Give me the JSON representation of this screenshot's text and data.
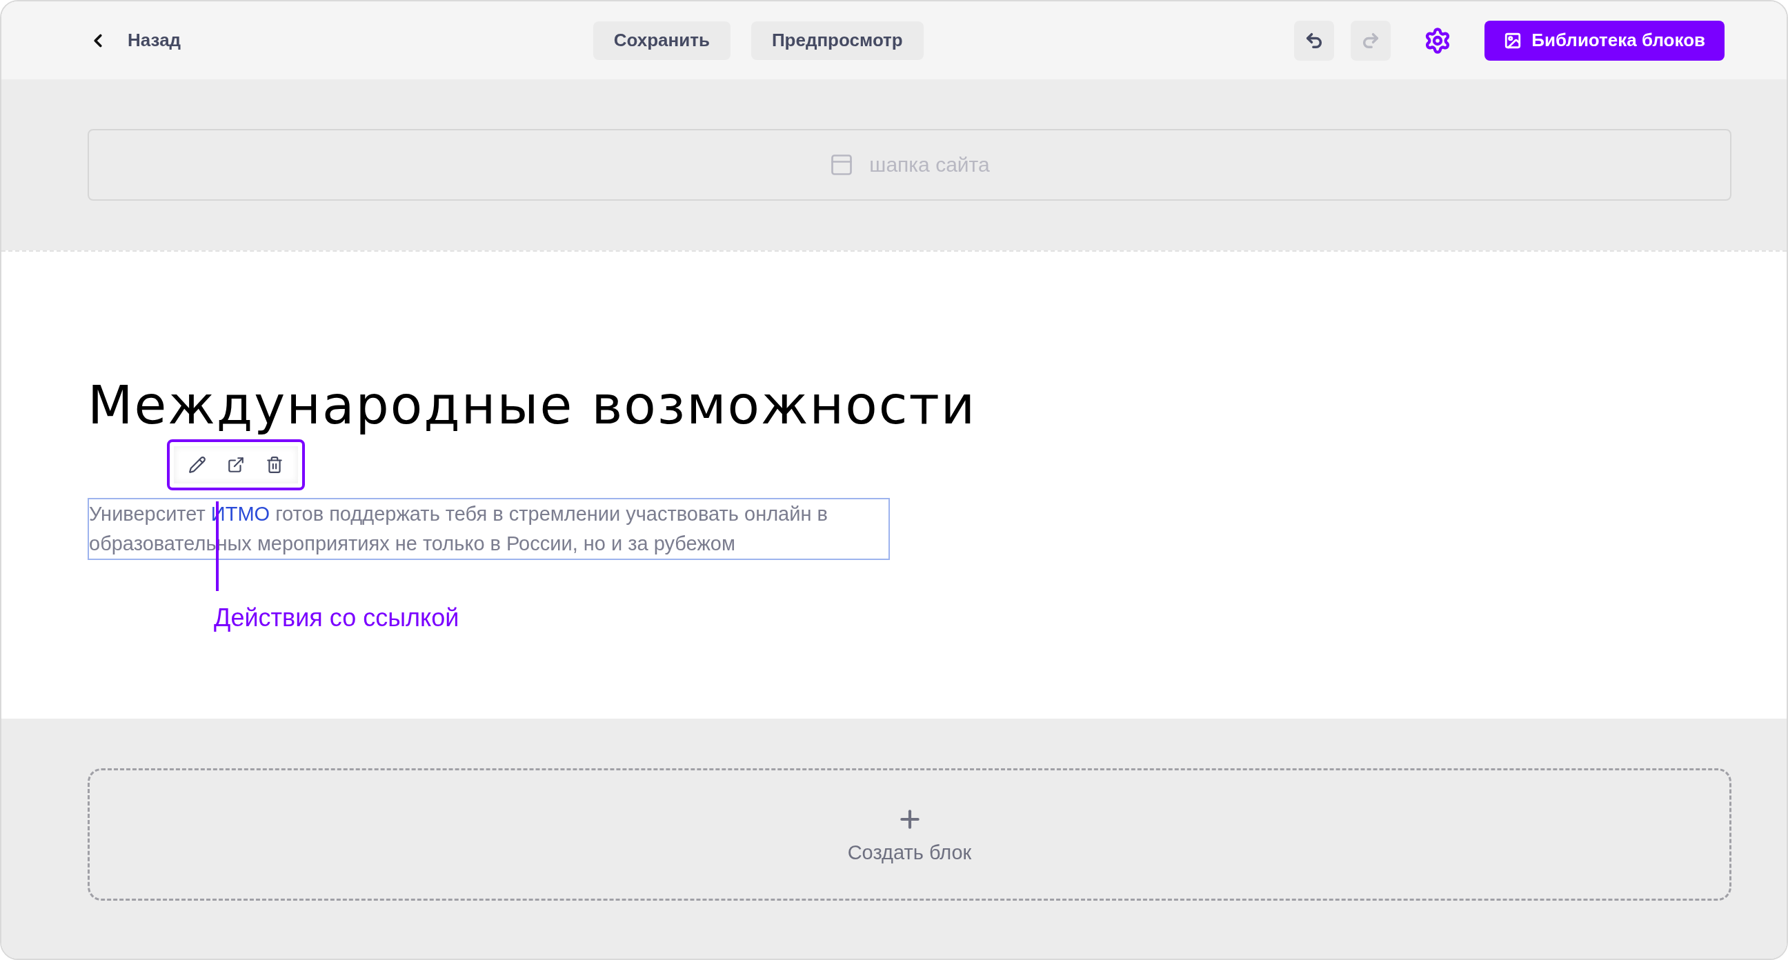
{
  "topbar": {
    "back": "Назад",
    "buttons": [
      {
        "label": "Сохранить"
      },
      {
        "label": "Предпросмотр"
      }
    ],
    "history": [
      {
        "kind": "undo",
        "disabled": false
      },
      {
        "kind": "redo",
        "disabled": true
      }
    ],
    "library_button": "Библиотека блоков"
  },
  "header_block": {
    "label": "шапка сайта"
  },
  "content": {
    "title": "Международные возможности",
    "paragraph": {
      "before": "Университет ",
      "link": "ИТМО",
      "after": " готов поддержать тебя в стремлении участвовать онлайн в образовательных мероприятиях не только в России, но и за рубежом"
    },
    "link_toolbar": {
      "actions": [
        {
          "kind": "edit"
        },
        {
          "kind": "open"
        },
        {
          "kind": "delete"
        }
      ]
    },
    "annotation": "Действия со ссылкой"
  },
  "create_block": {
    "label": "Создать блок"
  }
}
